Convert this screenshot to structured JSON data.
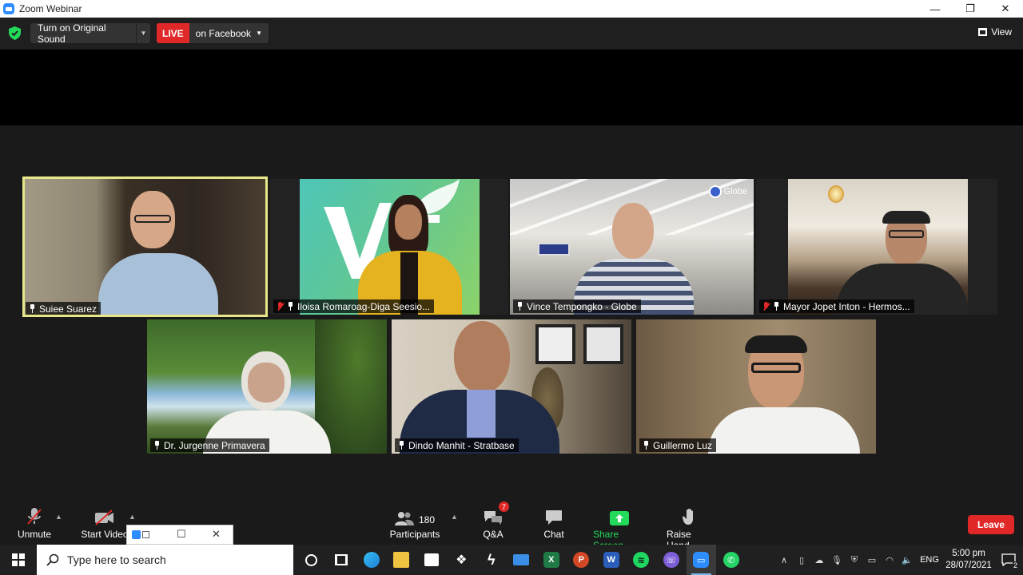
{
  "window": {
    "title": "Zoom Webinar",
    "minimize": "—",
    "maximize": "❐",
    "close": "✕"
  },
  "topbar": {
    "original_sound_label": "Turn on Original Sound",
    "live_label": "LIVE",
    "live_target": "on Facebook",
    "view_label": "View"
  },
  "participants_tiles": [
    {
      "name": "Suiee Suarez",
      "muted": false,
      "active_speaker": true
    },
    {
      "name": "Iloisa Romaroag-Diga Seesio...",
      "muted": true,
      "active_speaker": false
    },
    {
      "name": "Vince Tempongko - Globe",
      "muted": false,
      "active_speaker": false,
      "logo_text": "Globe"
    },
    {
      "name": "Mayor Jopet Inton - Hermos...",
      "muted": true,
      "active_speaker": false
    },
    {
      "name": "Dr. Jurgenne Primavera",
      "muted": false,
      "active_speaker": false
    },
    {
      "name": "Dindo Manhit - Stratbase",
      "muted": false,
      "active_speaker": false
    },
    {
      "name": "Guillermo Luz",
      "muted": false,
      "active_speaker": false
    }
  ],
  "toolbar": {
    "unmute": "Unmute",
    "start_video": "Start Video",
    "participants": "Participants",
    "participants_count": "180",
    "qa": "Q&A",
    "qa_badge": "7",
    "chat": "Chat",
    "share_screen": "Share Screen",
    "raise_hand": "Raise Hand",
    "leave": "Leave"
  },
  "taskbar": {
    "search_placeholder": "Type here to search",
    "language": "ENG",
    "time": "5:00 pm",
    "date": "28/07/2021",
    "notification_count": "2"
  },
  "colors": {
    "live_red": "#e02828",
    "active_speaker_border": "#e7e78a",
    "share_green": "#23d959",
    "zoom_blue": "#2d8cff"
  }
}
